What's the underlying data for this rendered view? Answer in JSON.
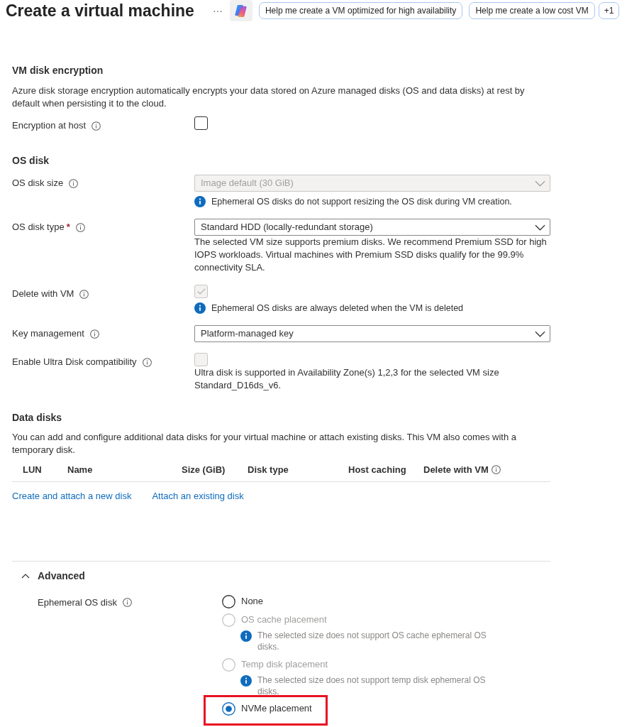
{
  "header": {
    "title": "Create a virtual machine",
    "more": "···",
    "suggestions": [
      "Help me create a VM optimized for high availability",
      "Help me create a low cost VM"
    ],
    "overflow": "+1"
  },
  "encryption": {
    "heading": "VM disk encryption",
    "description": "Azure disk storage encryption automatically encrypts your data stored on Azure managed disks (OS and data disks) at rest by default when persisting it to the cloud.",
    "fields": [
      {
        "kind": "checkbox",
        "label": "Encryption at host",
        "info": true,
        "checked": false,
        "disabled": false
      }
    ]
  },
  "os_disk": {
    "heading": "OS disk",
    "fields": [
      {
        "kind": "select",
        "label": "OS disk size",
        "info": true,
        "value": "Image default (30 GiB)",
        "disabled": true,
        "note": {
          "kind": "info",
          "text": "Ephemeral OS disks do not support resizing the OS disk during VM creation."
        }
      },
      {
        "kind": "select",
        "label": "OS disk type",
        "required_mark": "*",
        "info": true,
        "value": "Standard HDD (locally-redundant storage)",
        "disabled": false,
        "note": {
          "kind": "text",
          "text": "The selected VM size supports premium disks. We recommend Premium SSD for high IOPS workloads. Virtual machines with Premium SSD disks qualify for the 99.9% connectivity SLA."
        }
      },
      {
        "kind": "checkbox",
        "label": "Delete with VM",
        "info": true,
        "checked": true,
        "disabled": true,
        "note": {
          "kind": "info",
          "text": "Ephemeral OS disks are always deleted when the VM is deleted"
        }
      },
      {
        "kind": "select",
        "label": "Key management",
        "info": true,
        "value": "Platform-managed key",
        "disabled": false
      },
      {
        "kind": "checkbox",
        "label": "Enable Ultra Disk compatibility",
        "info": true,
        "checked": false,
        "disabled": true,
        "note": {
          "kind": "text",
          "text": "Ultra disk is supported in Availability Zone(s) 1,2,3 for the selected VM size Standard_D16ds_v6."
        }
      }
    ]
  },
  "data_disks": {
    "heading": "Data disks",
    "description": "You can add and configure additional data disks for your virtual machine or attach existing disks. This VM also comes with a temporary disk.",
    "columns": [
      {
        "label": "LUN",
        "info": false
      },
      {
        "label": "Name",
        "info": false
      },
      {
        "label": "Size (GiB)",
        "info": false
      },
      {
        "label": "Disk type",
        "info": false
      },
      {
        "label": "Host caching",
        "info": false
      },
      {
        "label": "Delete with VM",
        "info": true
      }
    ],
    "links": [
      "Create and attach a new disk",
      "Attach an existing disk"
    ]
  },
  "advanced": {
    "title": "Advanced",
    "expanded": true,
    "field": {
      "label": "Ephemeral OS disk",
      "info": true,
      "options": [
        {
          "label": "None",
          "selected": false,
          "disabled": false,
          "highlighted": false
        },
        {
          "label": "OS cache placement",
          "selected": false,
          "disabled": true,
          "highlighted": false,
          "note": "The selected size does not support OS cache ephemeral OS disks."
        },
        {
          "label": "Temp disk placement",
          "selected": false,
          "disabled": true,
          "highlighted": false,
          "note": "The selected size does not support temp disk ephemeral OS disks."
        },
        {
          "label": "NVMe placement",
          "selected": true,
          "disabled": false,
          "highlighted": true
        }
      ]
    }
  }
}
